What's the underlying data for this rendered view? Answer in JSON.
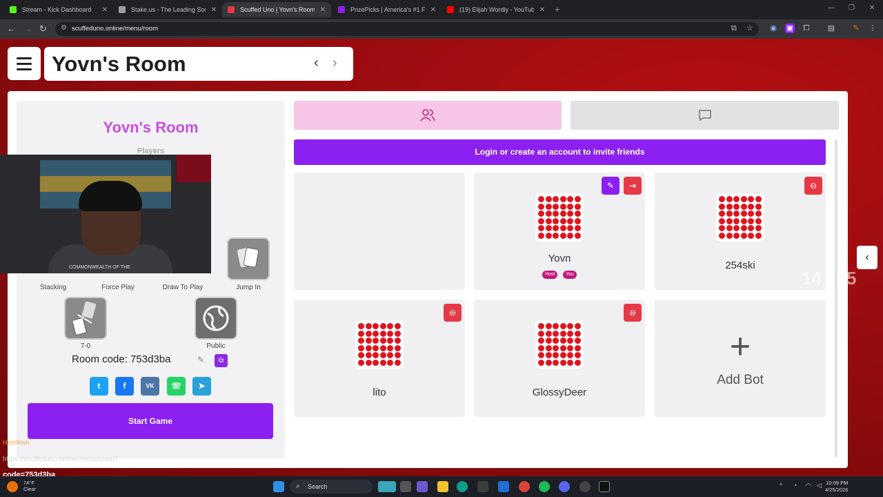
{
  "browser": {
    "tabs": [
      {
        "label": "Stream - Kick Dashboard",
        "color": "#53fc18"
      },
      {
        "label": "Stake.us - The Leading Social C",
        "color": "#9aa0a6"
      },
      {
        "label": "Scuffed Uno | Yovn's Room",
        "color": "#e53945"
      },
      {
        "label": "PrizePicks | America's #1 Fanta",
        "color": "#8b20f0"
      },
      {
        "label": "(19) Elijah Wordly - YouTube",
        "color": "#ff0000"
      }
    ],
    "url": "scuffeduno.online/menu/room"
  },
  "header": {
    "title": "Yovn's Room"
  },
  "left": {
    "room_name": "Yovn's Room",
    "players_label": "Players",
    "rules": [
      {
        "label": "Stacking"
      },
      {
        "label": "Force Play"
      },
      {
        "label": "Draw To Play"
      },
      {
        "label": "Jump In"
      },
      {
        "label": "7-0"
      },
      {
        "label": "Public"
      }
    ],
    "room_code": "Room code: 753d3ba",
    "start_button": "Start Game"
  },
  "right": {
    "invite_text": "Login or create an account to invite friends",
    "players": [
      {
        "name": "Yovn",
        "badges": [
          "Host",
          "You"
        ]
      },
      {
        "name": "254ski"
      },
      {
        "name": "lito"
      },
      {
        "name": "GlossyDeer"
      }
    ],
    "add_bot": "Add Bot"
  },
  "overlay": {
    "counter": "14 / 25",
    "cam_caption": "COMMONWEALTH OF THE",
    "stream_label": "HostYovn",
    "status_url": "https://scuffeduno.online/menu/room?",
    "status_code": "code=753d3ba"
  },
  "taskbar": {
    "weather_temp": "74°F",
    "weather_desc": "Clear",
    "search": "Search",
    "time": "10:09 PM",
    "date": "4/25/2026"
  }
}
